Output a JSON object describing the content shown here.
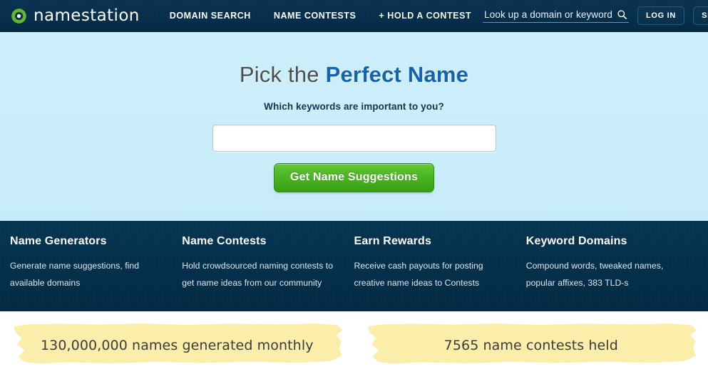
{
  "brand": {
    "name": "namestation",
    "logo_icon": "target-ring-icon",
    "accent_green": "#5cb030",
    "nav_bg": "#07304e",
    "hero_bg": "#cbedfa",
    "highlight_yellow": "#faeeaa"
  },
  "nav": {
    "links": [
      {
        "label": "DOMAIN SEARCH",
        "accent": false
      },
      {
        "label": "NAME CONTESTS",
        "accent": false
      },
      {
        "label": "+ HOLD A CONTEST",
        "accent": true
      }
    ],
    "search": {
      "placeholder": "Look up a domain or keyword",
      "value": "",
      "icon": "search-icon"
    },
    "login_label": "LOG IN",
    "signup_label": "SIGN UP"
  },
  "hero": {
    "title_plain": "Pick the ",
    "title_strong": "Perfect Name",
    "subtitle": "Which keywords are important to you?",
    "keyword_input": {
      "value": "",
      "placeholder": ""
    },
    "submit_label": "Get Name Suggestions"
  },
  "features": [
    {
      "title": "Name Generators",
      "desc": "Generate name suggestions, find available domains"
    },
    {
      "title": "Name Contests",
      "desc": "Hold crowdsourced naming contests to get name ideas from our community"
    },
    {
      "title": "Earn Rewards",
      "desc": "Receive cash payouts for posting creative name ideas to Contests"
    },
    {
      "title": "Keyword Domains",
      "desc": "Compound words, tweaked names, popular affixes, 383 TLD-s"
    }
  ],
  "stats": [
    {
      "text": "130,000,000 names generated monthly"
    },
    {
      "text": "7565 name contests held"
    }
  ]
}
